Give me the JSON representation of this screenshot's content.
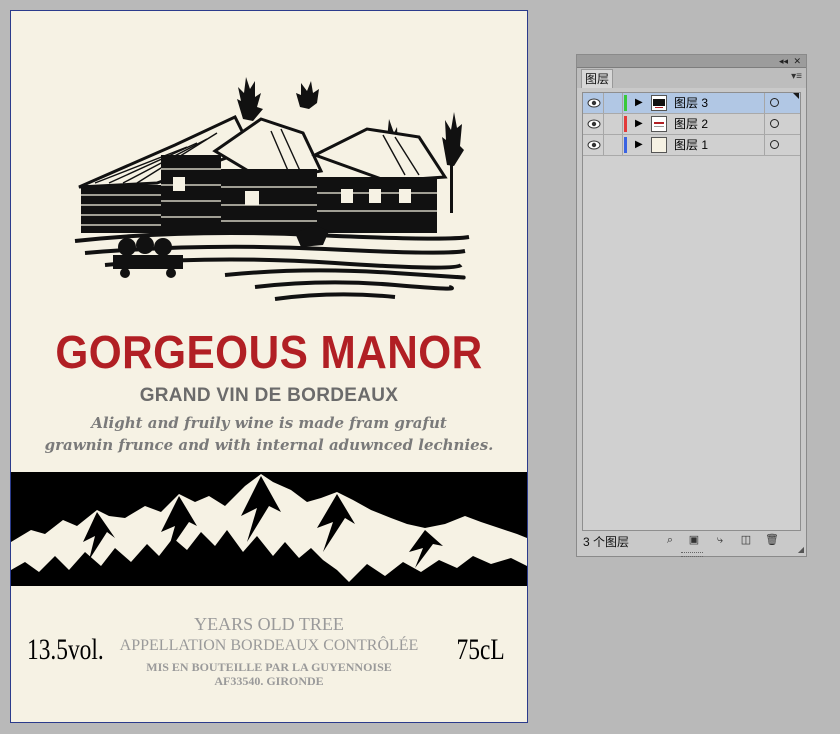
{
  "label": {
    "brand": "GORGEOUS MANOR",
    "subtitle": "GRAND VIN DE BORDEAUX",
    "tagline_1": "Alight and fruily wine is made fram grafut",
    "tagline_2": "grawnin frunce and with internal aduwnced lechnies.",
    "years": "YEARS OLD TREE",
    "appellation": "APPELLATION BORDEAUX CONTRÔLÉE",
    "bottled": "MIS EN BOUTEILLE PAR LA GUYENNOISE",
    "code": "AF33540. GIRONDE",
    "volume": "13.5vol.",
    "size": "75cL",
    "colors": {
      "brand": "#b11f24",
      "background": "#f6f2e4",
      "band": "#000000"
    },
    "illustration_icon": "farmhouse-engraving-icon",
    "band_icon": "mountain-range-icon"
  },
  "panel": {
    "tab_label": "图层",
    "collapse_glyph": "◂◂",
    "close_glyph": "✕",
    "menu_glyph": "▾≡",
    "layers": [
      {
        "name": "图层 3",
        "color": "#38c93a",
        "selected": true
      },
      {
        "name": "图层 2",
        "color": "#e23a3a",
        "selected": false
      },
      {
        "name": "图层 1",
        "color": "#3a63e2",
        "selected": false
      }
    ],
    "footer": {
      "count_label": "3 个图层",
      "icons": [
        "search-icon",
        "clipping-mask-icon",
        "sublayer-icon",
        "new-layer-icon",
        "trash-icon"
      ]
    }
  }
}
